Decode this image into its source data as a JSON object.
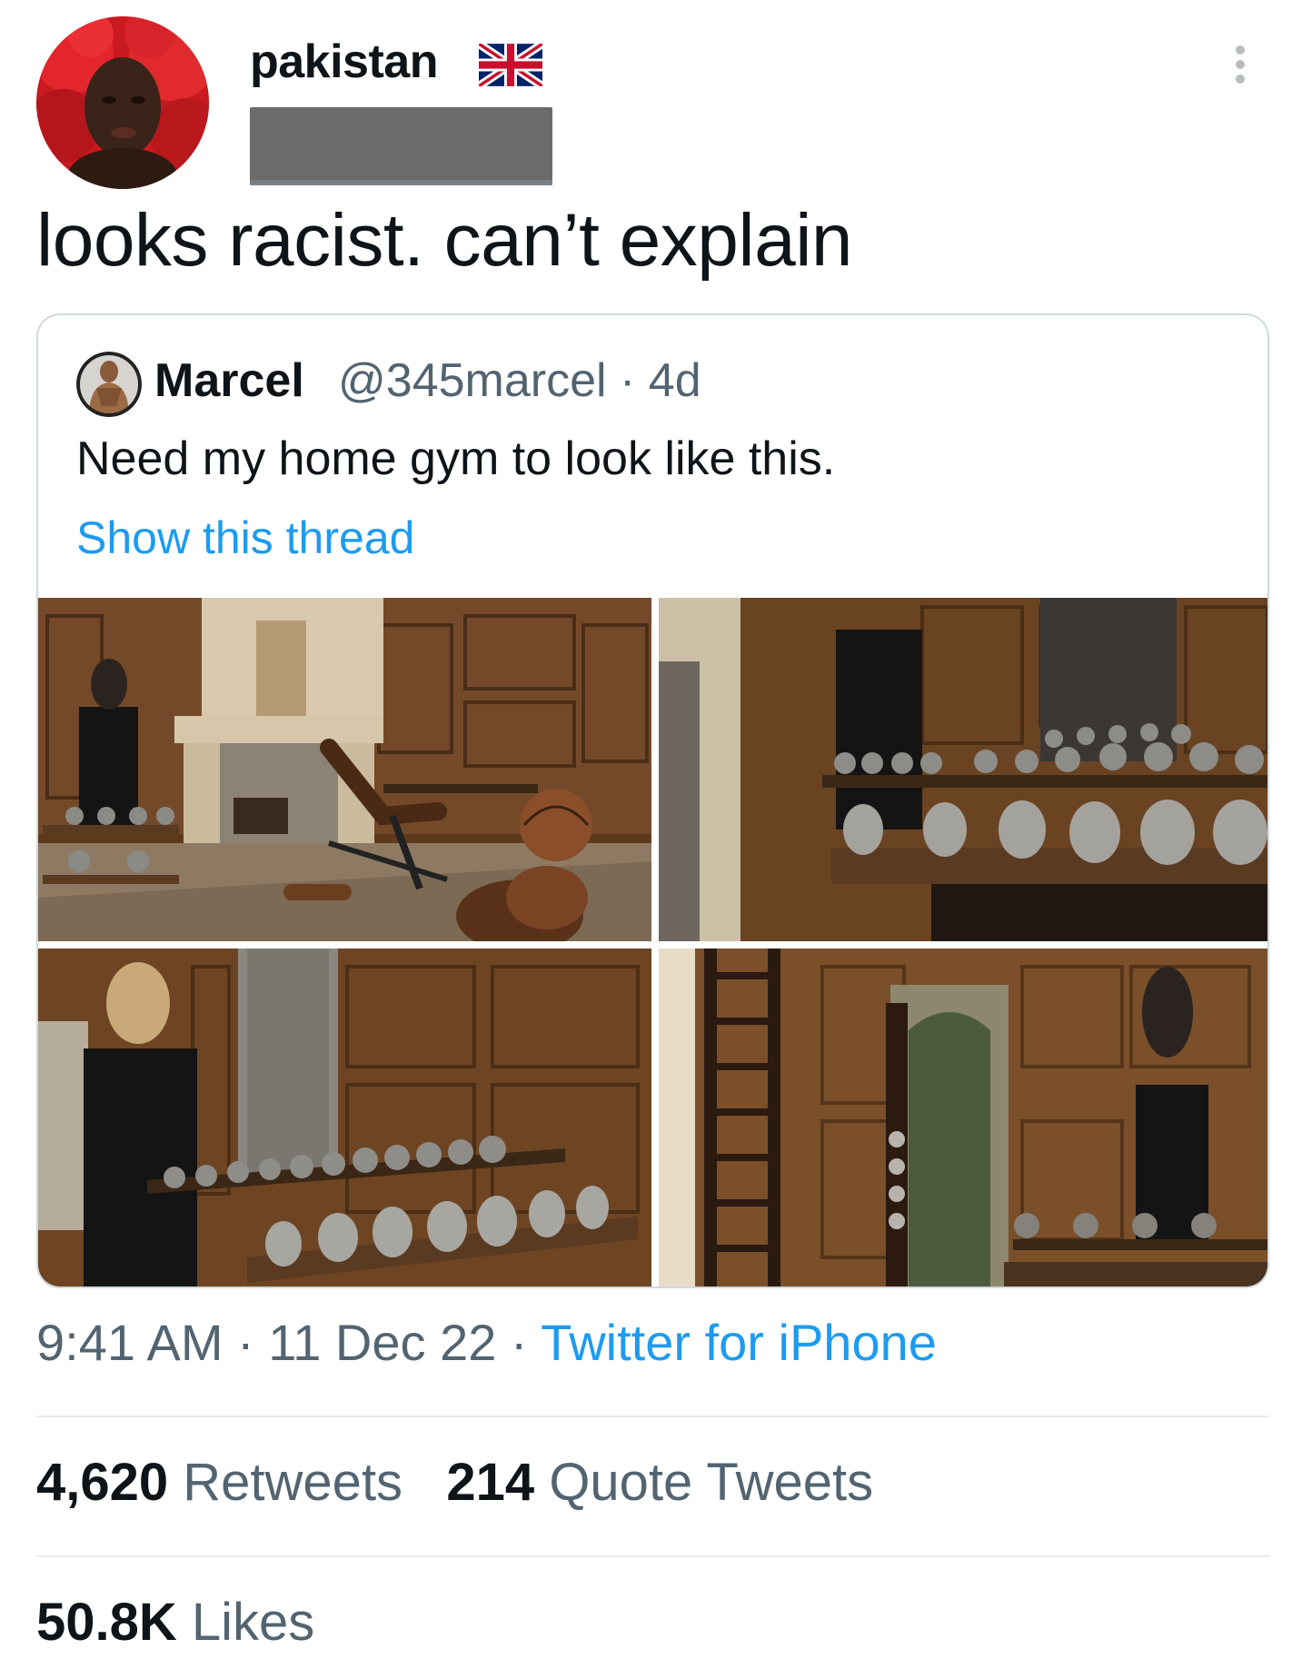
{
  "author": {
    "display_name": "pakistan",
    "flag_icon": "uk-flag-icon",
    "avatar_icon": "profile-avatar"
  },
  "tweet": {
    "text": "looks racist. can’t explain"
  },
  "quoted_tweet": {
    "name": "Marcel",
    "handle_and_time": "@345marcel · 4d",
    "text": "Need my home gym to look like this.",
    "show_thread": "Show this thread"
  },
  "meta": {
    "time": "9:41 AM",
    "sep1": " · ",
    "date": "11 Dec 22",
    "sep2": " · ",
    "source": "Twitter for iPhone"
  },
  "stats": {
    "retweets_count": "4,620",
    "retweets_label": "Retweets",
    "quotes_count": "214",
    "quotes_label": "Quote Tweets",
    "likes_count": "50.8K",
    "likes_label": "Likes"
  },
  "colors": {
    "link": "#1d9bf0",
    "secondary_text": "#536471",
    "primary_text": "#0f1419",
    "wood": "#7a4f27",
    "black_plinth": "#141414"
  }
}
